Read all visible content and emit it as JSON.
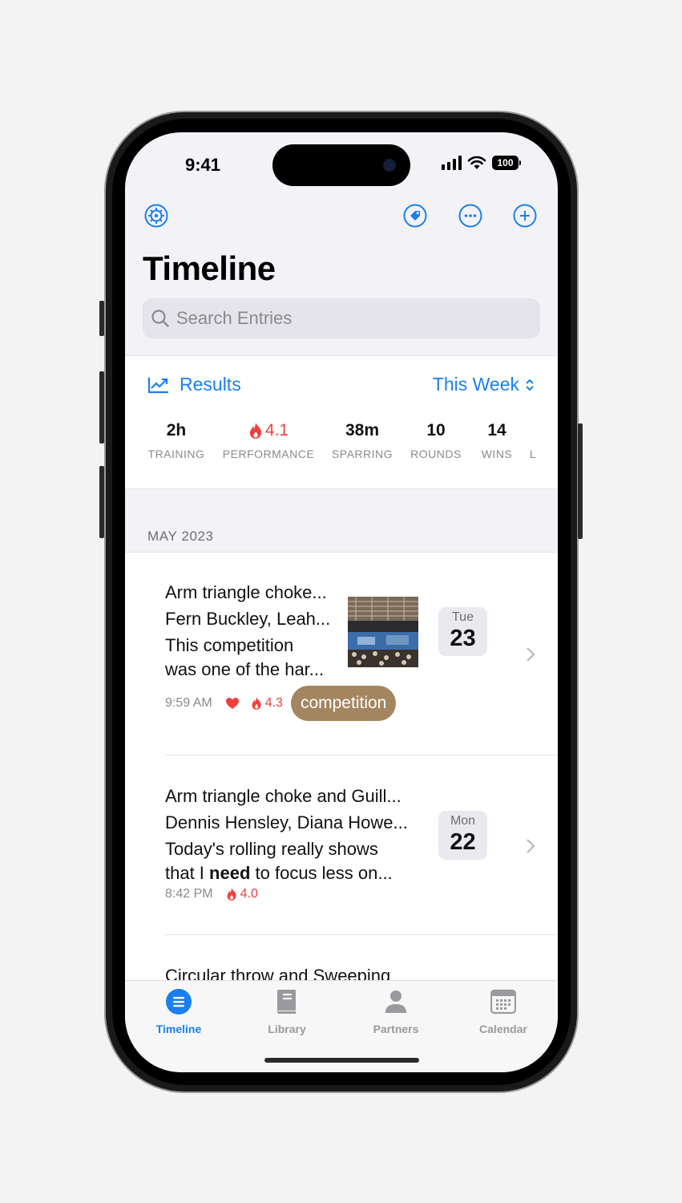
{
  "status": {
    "time": "9:41",
    "battery": "100"
  },
  "nav": {
    "title": "Timeline"
  },
  "search": {
    "placeholder": "Search Entries"
  },
  "results": {
    "label": "Results",
    "period": "This Week",
    "stats": [
      {
        "value": "2h",
        "label": "TRAINING"
      },
      {
        "value": "4.1",
        "label": "PERFORMANCE"
      },
      {
        "value": "38m",
        "label": "SPARRING"
      },
      {
        "value": "10",
        "label": "ROUNDS"
      },
      {
        "value": "14",
        "label": "WINS"
      },
      {
        "value": "",
        "label": "L"
      }
    ]
  },
  "section": {
    "header": "MAY 2023"
  },
  "entries": [
    {
      "line1": "Arm triangle choke...",
      "line2": "Fern Buckley, Leah...",
      "line3": "This competition",
      "line4": "was one of the har...",
      "time": "9:59 AM",
      "score": "4.3",
      "tag": "competition",
      "dow": "Tue",
      "day": "23"
    },
    {
      "line1": "Arm triangle choke and Guill...",
      "line2": "Dennis Hensley, Diana Howe...",
      "line3": "Today's rolling really shows",
      "line4_pre": "that I ",
      "line4_bold": "need",
      "line4_post": " to focus less on...",
      "time": "8:42 PM",
      "score": "4.0",
      "dow": "Mon",
      "day": "22"
    },
    {
      "line1": "Circular throw and Sweeping"
    }
  ],
  "tabs": [
    {
      "label": "Timeline",
      "icon": "list-icon",
      "active": true
    },
    {
      "label": "Library",
      "icon": "book-icon",
      "active": false
    },
    {
      "label": "Partners",
      "icon": "person-icon",
      "active": false
    },
    {
      "label": "Calendar",
      "icon": "calendar-icon",
      "active": false
    }
  ],
  "colors": {
    "accent": "#1a7ff0",
    "red": "#f0403a",
    "tag": "#a38660"
  }
}
